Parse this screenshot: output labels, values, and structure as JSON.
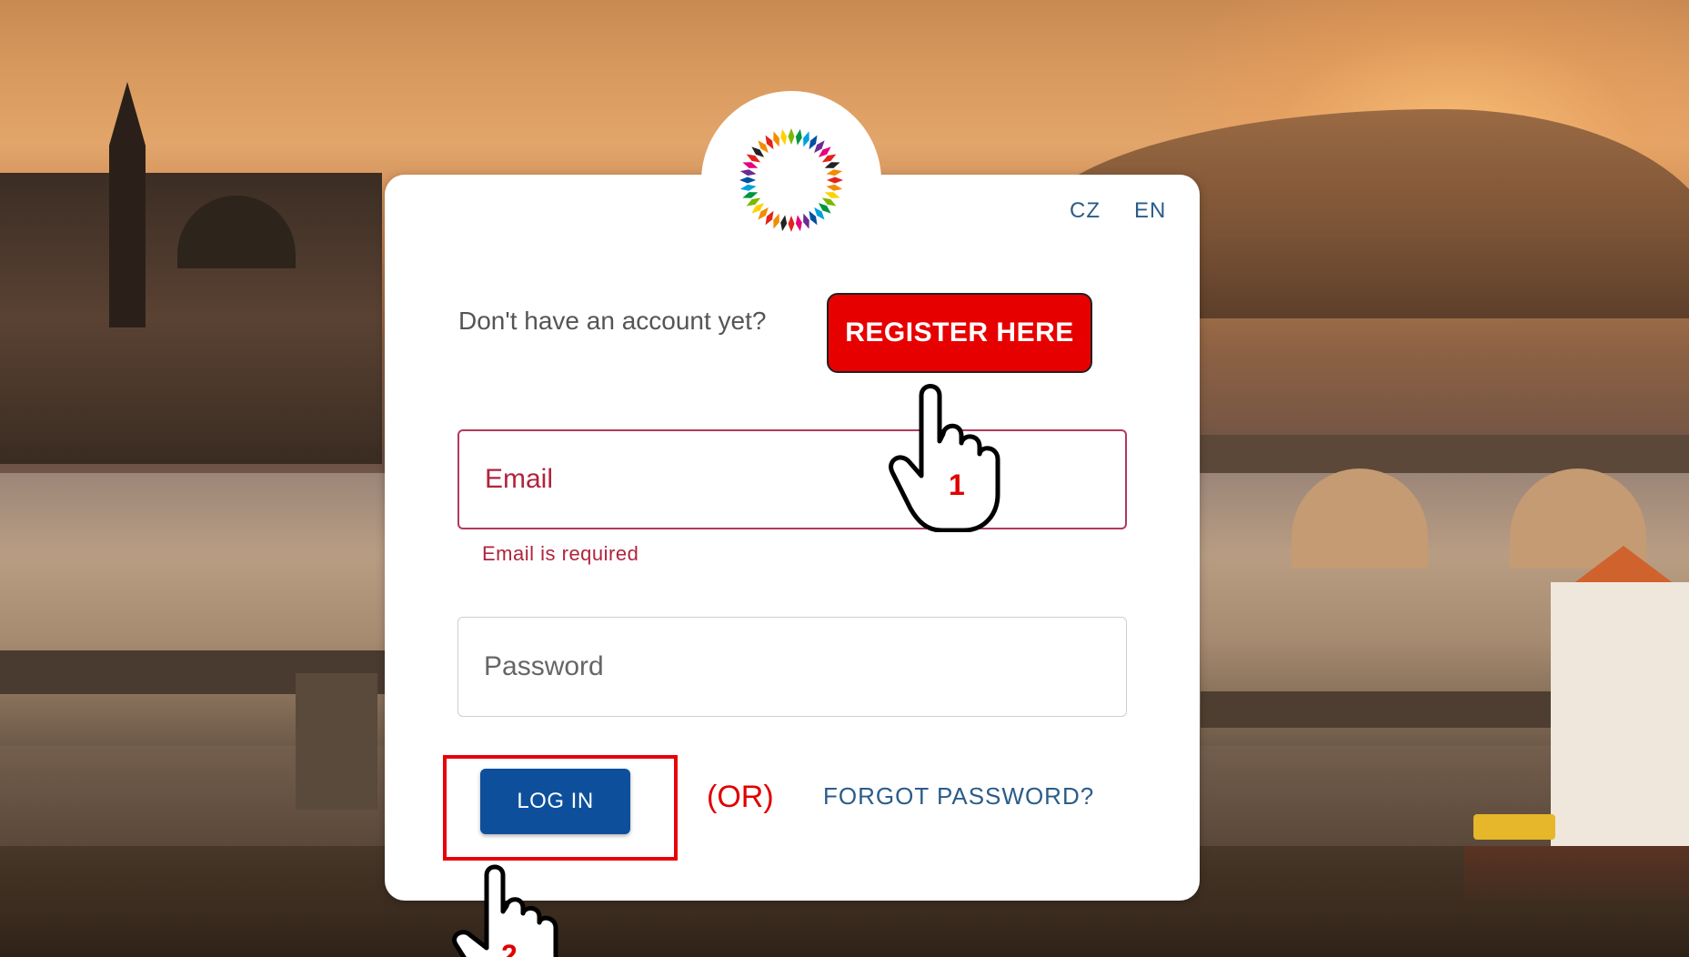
{
  "language_switcher": {
    "cz": "CZ",
    "en": "EN"
  },
  "register": {
    "prompt": "Don't have an account yet?",
    "button_label": "REGISTER HERE"
  },
  "form": {
    "email_placeholder": "Email",
    "email_error": "Email is required",
    "password_placeholder": "Password"
  },
  "actions": {
    "login_label": "LOG IN",
    "or_label": "(OR)",
    "forgot_label": "FORGOT PASSWORD?"
  },
  "annotations": {
    "step_1": "1",
    "step_2": "2"
  },
  "colors": {
    "accent_red": "#e60000",
    "login_blue": "#0e4f9c",
    "link_blue": "#2a5c8a",
    "error_red": "#b0243c"
  },
  "icons": {
    "logo": "rainbow-diamond-ring-logo",
    "pointer": "pointing-hand-icon"
  }
}
